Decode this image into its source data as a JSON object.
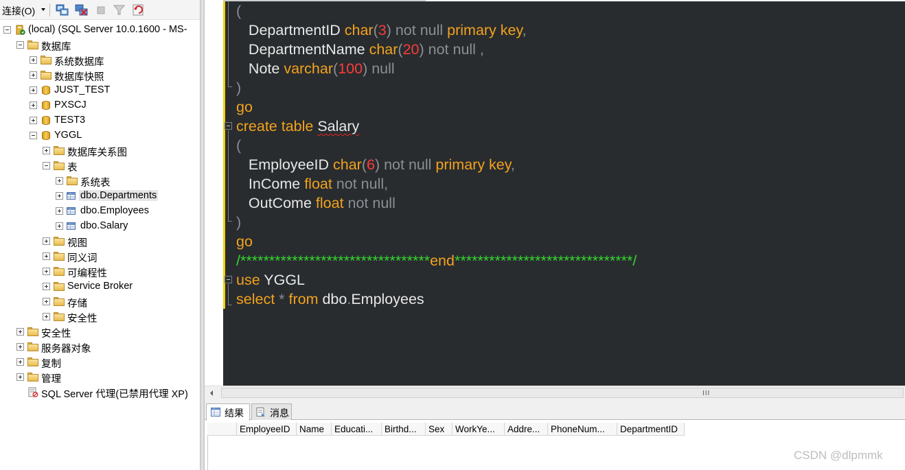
{
  "toolbar": {
    "connect_label": "连接(O)",
    "icons": [
      "connect-icon",
      "disconnect-icon",
      "stop-icon",
      "filter-icon",
      "refresh-icon"
    ]
  },
  "tree": [
    {
      "label": "(local) (SQL Server 10.0.1600 - MS-",
      "icon": "server-icon",
      "expanded": true,
      "depth": 0
    },
    {
      "label": "数据库",
      "icon": "folder-icon",
      "expanded": true,
      "depth": 1
    },
    {
      "label": "系统数据库",
      "icon": "folder-icon",
      "expanded": false,
      "depth": 2
    },
    {
      "label": "数据库快照",
      "icon": "folder-icon",
      "expanded": false,
      "depth": 2
    },
    {
      "label": "JUST_TEST",
      "icon": "database-icon",
      "expanded": false,
      "depth": 2
    },
    {
      "label": "PXSCJ",
      "icon": "database-icon",
      "expanded": false,
      "depth": 2
    },
    {
      "label": "TEST3",
      "icon": "database-icon",
      "expanded": false,
      "depth": 2
    },
    {
      "label": "YGGL",
      "icon": "database-icon",
      "expanded": true,
      "depth": 2
    },
    {
      "label": "数据库关系图",
      "icon": "folder-icon",
      "expanded": false,
      "depth": 3
    },
    {
      "label": "表",
      "icon": "folder-icon",
      "expanded": true,
      "depth": 3
    },
    {
      "label": "系统表",
      "icon": "folder-icon",
      "expanded": false,
      "depth": 4
    },
    {
      "label": "dbo.Departments",
      "icon": "table-icon",
      "expanded": false,
      "depth": 4,
      "selected": true
    },
    {
      "label": "dbo.Employees",
      "icon": "table-icon",
      "expanded": false,
      "depth": 4
    },
    {
      "label": "dbo.Salary",
      "icon": "table-icon",
      "expanded": false,
      "depth": 4
    },
    {
      "label": "视图",
      "icon": "folder-icon",
      "expanded": false,
      "depth": 3
    },
    {
      "label": "同义词",
      "icon": "folder-icon",
      "expanded": false,
      "depth": 3
    },
    {
      "label": "可编程性",
      "icon": "folder-icon",
      "expanded": false,
      "depth": 3
    },
    {
      "label": "Service Broker",
      "icon": "folder-icon",
      "expanded": false,
      "depth": 3
    },
    {
      "label": "存储",
      "icon": "folder-icon",
      "expanded": false,
      "depth": 3
    },
    {
      "label": "安全性",
      "icon": "folder-icon",
      "expanded": false,
      "depth": 3
    },
    {
      "label": "安全性",
      "icon": "folder-icon",
      "expanded": false,
      "depth": 1
    },
    {
      "label": "服务器对象",
      "icon": "folder-icon",
      "expanded": false,
      "depth": 1
    },
    {
      "label": "复制",
      "icon": "folder-icon",
      "expanded": false,
      "depth": 1
    },
    {
      "label": "管理",
      "icon": "folder-icon",
      "expanded": false,
      "depth": 1
    },
    {
      "label": "SQL Server 代理(已禁用代理 XP)",
      "icon": "agent-icon",
      "expanded": null,
      "depth": 1
    }
  ],
  "editor": {
    "lines": [
      [
        [
          "op",
          "("
        ]
      ],
      [
        [
          "id",
          "   DepartmentID "
        ],
        [
          "kw",
          "char"
        ],
        [
          "op",
          "("
        ],
        [
          "num",
          "3"
        ],
        [
          "op",
          ") not null "
        ],
        [
          "kw",
          "primary key"
        ],
        [
          "op",
          ","
        ]
      ],
      [
        [
          "id",
          "   DepartmentName "
        ],
        [
          "kw",
          "char"
        ],
        [
          "op",
          "("
        ],
        [
          "num",
          "20"
        ],
        [
          "op",
          ") not null ,"
        ]
      ],
      [
        [
          "id",
          "   Note "
        ],
        [
          "kw",
          "varchar"
        ],
        [
          "op",
          "("
        ],
        [
          "num",
          "100"
        ],
        [
          "op",
          ") null"
        ]
      ],
      [
        [
          "op",
          ")"
        ]
      ],
      [
        [
          "kw",
          "go"
        ]
      ],
      [
        [
          "kw",
          "create table "
        ],
        [
          "idsq",
          "Salary"
        ]
      ],
      [
        [
          "op",
          "("
        ]
      ],
      [
        [
          "id",
          "   EmployeeID "
        ],
        [
          "kw",
          "char"
        ],
        [
          "op",
          "("
        ],
        [
          "num",
          "6"
        ],
        [
          "op",
          ") not null "
        ],
        [
          "kw",
          "primary key"
        ],
        [
          "op",
          ","
        ]
      ],
      [
        [
          "id",
          "   InCome "
        ],
        [
          "kw",
          "float"
        ],
        [
          "op",
          " not null,"
        ]
      ],
      [
        [
          "id",
          "   OutCome "
        ],
        [
          "kw",
          "float"
        ],
        [
          "op",
          " not null"
        ]
      ],
      [
        [
          "op",
          ")"
        ]
      ],
      [
        [
          "kw",
          "go"
        ]
      ],
      [
        [
          "cmt",
          "/*********************************"
        ],
        [
          "kw2",
          "end"
        ],
        [
          "cmt",
          "*******************************/"
        ]
      ],
      [
        [
          "kw",
          "use "
        ],
        [
          "id",
          "YGGL"
        ]
      ],
      [
        [
          "kw",
          "select "
        ],
        [
          "op",
          "* "
        ],
        [
          "kw",
          "from "
        ],
        [
          "id",
          "dbo"
        ],
        [
          "op",
          "."
        ],
        [
          "id",
          "Employees"
        ]
      ]
    ]
  },
  "scrollbar": {
    "grip": "III"
  },
  "results": {
    "tabs": [
      {
        "label": "结果",
        "icon": "grid-icon",
        "active": true
      },
      {
        "label": "消息",
        "icon": "message-icon",
        "active": false
      }
    ],
    "columns": [
      "",
      "EmployeeID",
      "Name",
      "Educati...",
      "Birthd...",
      "Sex",
      "WorkYe...",
      "Addre...",
      "PhoneNum...",
      "DepartmentID"
    ]
  },
  "watermark": "CSDN @dlpmmk",
  "colors": {
    "editor_bg": "#282c2f",
    "keyword": "#f3a21d",
    "number": "#ff3a3a",
    "comment": "#37d52f",
    "identifier": "#e8e8e8",
    "operator": "#8a8f94",
    "change_bar": "#f3d000"
  }
}
